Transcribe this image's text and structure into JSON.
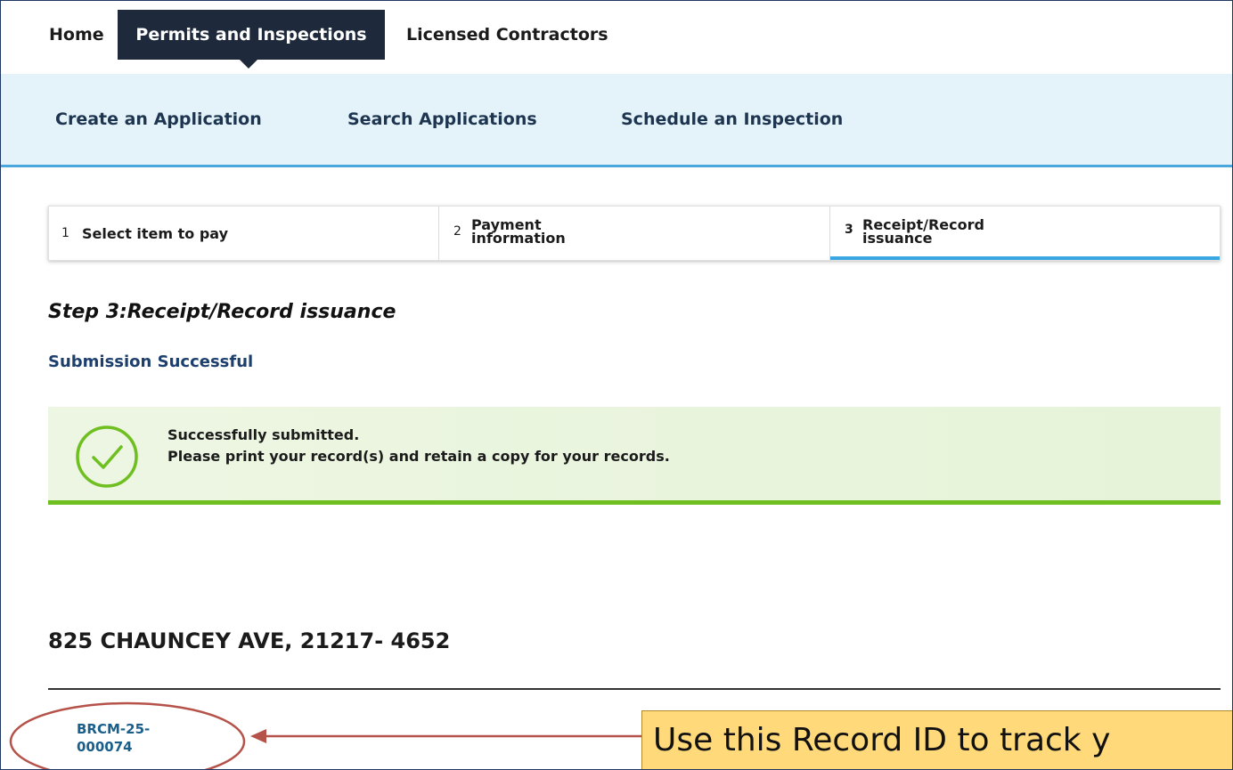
{
  "top_nav": {
    "home": "Home",
    "permits": "Permits and Inspections",
    "licensed": "Licensed Contractors"
  },
  "sub_nav": {
    "create": "Create an Application",
    "search": "Search Applications",
    "schedule": "Schedule an Inspection"
  },
  "steps": [
    {
      "num": "1",
      "label": "Select item to pay"
    },
    {
      "num": "2",
      "label_line1": "Payment",
      "label_line2": "information"
    },
    {
      "num": "3",
      "label_line1": "Receipt/Record",
      "label_line2": "issuance"
    }
  ],
  "heading": "Step 3:Receipt/Record issuance",
  "submission_label": "Submission Successful",
  "alert": {
    "line1": "Successfully submitted.",
    "line2": "Please print your record(s) and retain a copy for your records."
  },
  "address": "825 CHAUNCEY AVE, 21217- 4652",
  "record": {
    "line1": "BRCM-25-",
    "line2": "000074"
  },
  "callout": "Use this Record ID to track y",
  "colors": {
    "nav_active": "#1e2a3b",
    "subnav_bg": "#e4f2fa",
    "step_active": "#3aa7e3",
    "success_green": "#6ebf1f",
    "callout_bg": "#ffd97a",
    "annotation_red": "#b5524a"
  },
  "icons": {
    "success": "check-circle-icon",
    "pointer": "arrow-left-icon"
  }
}
